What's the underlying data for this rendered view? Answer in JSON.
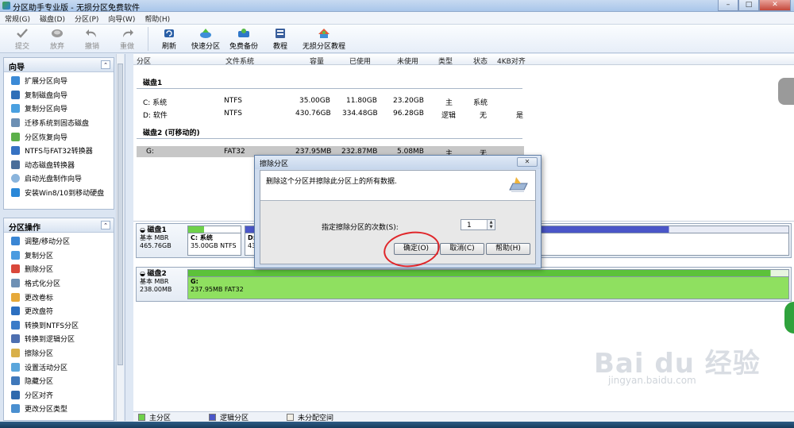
{
  "window": {
    "title": "分区助手专业版 - 无损分区免费软件"
  },
  "menu": [
    "常规(G)",
    "磁盘(D)",
    "分区(P)",
    "向导(W)",
    "帮助(H)"
  ],
  "toolbar": [
    {
      "label": "提交",
      "icon": "check-icon",
      "disabled": true
    },
    {
      "label": "放弃",
      "icon": "discard-icon",
      "disabled": true
    },
    {
      "label": "撤销",
      "icon": "undo-icon",
      "disabled": true
    },
    {
      "label": "重做",
      "icon": "redo-icon",
      "disabled": true
    },
    {
      "label": "刷新",
      "icon": "refresh-icon",
      "disabled": false
    },
    {
      "label": "快速分区",
      "icon": "quick-partition-icon",
      "disabled": false
    },
    {
      "label": "免费备份",
      "icon": "backup-icon",
      "disabled": false
    },
    {
      "label": "教程",
      "icon": "tutorial-icon",
      "disabled": false
    },
    {
      "label": "无损分区教程",
      "icon": "lossless-tutorial-icon",
      "disabled": false
    }
  ],
  "wizard": {
    "title": "向导",
    "items": [
      "扩展分区向导",
      "复制磁盘向导",
      "复制分区向导",
      "迁移系统到固态磁盘",
      "分区恢复向导",
      "NTFS与FAT32转换器",
      "动态磁盘转换器",
      "启动光盘制作向导",
      "安装Win8/10到移动硬盘"
    ]
  },
  "ops": {
    "title": "分区操作",
    "items": [
      "调整/移动分区",
      "复制分区",
      "删除分区",
      "格式化分区",
      "更改卷标",
      "更改盘符",
      "转换到NTFS分区",
      "转换到逻辑分区",
      "擦除分区",
      "设置活动分区",
      "隐藏分区",
      "分区对齐",
      "更改分区类型"
    ]
  },
  "columns": [
    "分区",
    "文件系统",
    "容量",
    "已使用",
    "未使用",
    "类型",
    "状态",
    "4KB对齐"
  ],
  "disks": [
    {
      "label": "磁盘1",
      "rows": [
        {
          "name": "C: 系统",
          "fs": "NTFS",
          "cap": "35.00GB",
          "used": "11.80GB",
          "free": "23.20GB",
          "type": "主",
          "status": "系统",
          "align": ""
        },
        {
          "name": "D: 软件",
          "fs": "NTFS",
          "cap": "430.76GB",
          "used": "334.48GB",
          "free": "96.28GB",
          "type": "逻辑",
          "status": "无",
          "align": "是"
        }
      ]
    },
    {
      "label": "磁盘2 (可移动的)",
      "rows": [
        {
          "name": "G:",
          "fs": "FAT32",
          "cap": "237.95MB",
          "used": "232.87MB",
          "free": "5.08MB",
          "type": "主",
          "status": "无",
          "align": ""
        }
      ]
    }
  ],
  "diskmap": [
    {
      "name": "磁盘1",
      "kind": "基本 MBR",
      "size": "465.76GB",
      "parts": [
        {
          "title": "C: 系统",
          "sub": "35.00GB NTFS"
        },
        {
          "title": "D:",
          "sub": "43"
        }
      ]
    },
    {
      "name": "磁盘2",
      "kind": "基本 MBR",
      "size": "238.00MB",
      "parts": [
        {
          "title": "G:",
          "sub": "237.95MB FAT32"
        }
      ]
    }
  ],
  "legend": [
    "主分区",
    "逻辑分区",
    "未分配空间"
  ],
  "colors": {
    "primary": "#6fd14a",
    "logical": "#4a56c8",
    "unallocated": "#f2efe6"
  },
  "dialog": {
    "title": "擦除分区",
    "message": "删除这个分区并擦除此分区上的所有数据.",
    "label": "指定擦除分区的次数(S):",
    "count": "1",
    "ok": "确定(O)",
    "cancel": "取消(C)",
    "help": "帮助(H)"
  },
  "watermark": {
    "text": "Bai du 经验",
    "url": "jingyan.baidu.com"
  }
}
